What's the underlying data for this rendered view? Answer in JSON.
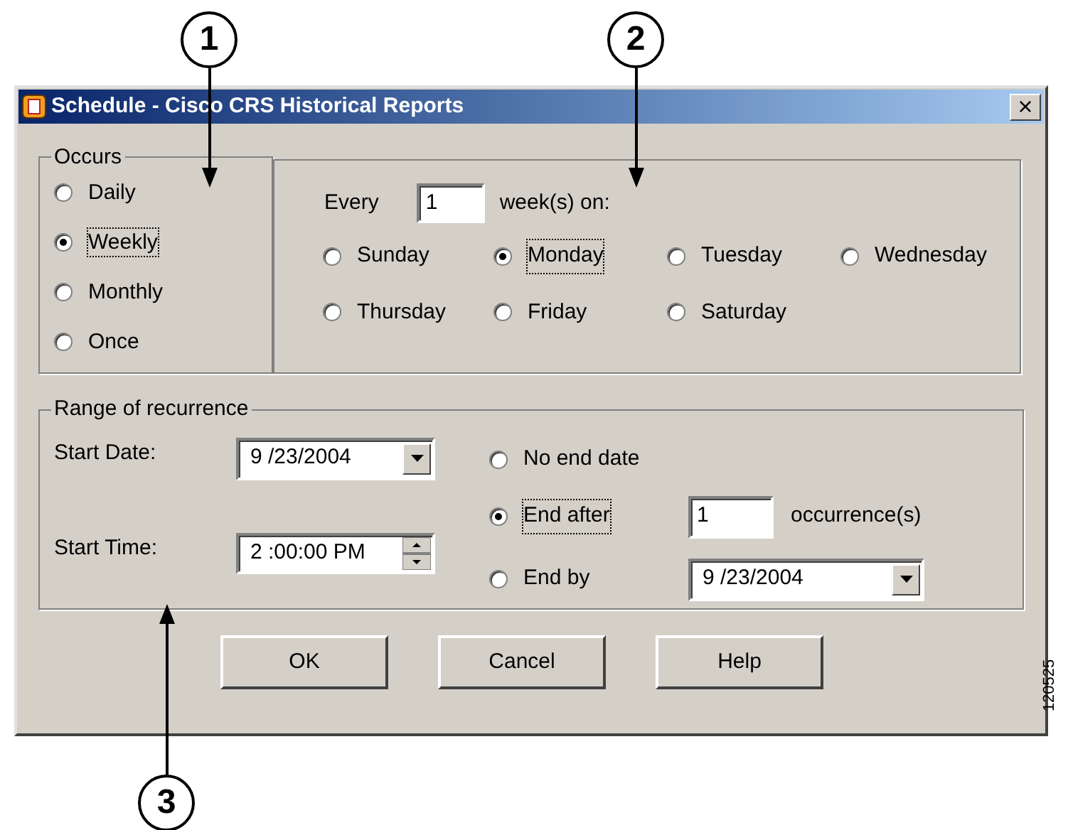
{
  "callouts": [
    "1",
    "2",
    "3"
  ],
  "window": {
    "title": "Schedule - Cisco CRS Historical Reports",
    "close": "×"
  },
  "occurs": {
    "legend": "Occurs",
    "options": [
      {
        "label": "Daily",
        "selected": false
      },
      {
        "label": "Weekly",
        "selected": true
      },
      {
        "label": "Monthly",
        "selected": false
      },
      {
        "label": "Once",
        "selected": false
      }
    ]
  },
  "weekly": {
    "every_label": "Every",
    "every_value": "1",
    "unit_label": "week(s) on:",
    "days": [
      {
        "label": "Sunday",
        "selected": false
      },
      {
        "label": "Monday",
        "selected": true
      },
      {
        "label": "Tuesday",
        "selected": false
      },
      {
        "label": "Wednesday",
        "selected": false
      },
      {
        "label": "Thursday",
        "selected": false
      },
      {
        "label": "Friday",
        "selected": false
      },
      {
        "label": "Saturday",
        "selected": false
      }
    ]
  },
  "range": {
    "legend": "Range of recurrence",
    "start_date_label": "Start Date:",
    "start_date": "9 /23/2004",
    "start_time_label": "Start Time:",
    "start_time": "2 :00:00 PM",
    "end_options": [
      {
        "kind": "none",
        "label": "No end date",
        "selected": false
      },
      {
        "kind": "count",
        "label": "End after",
        "selected": true,
        "value": "1",
        "suffix": "occurrence(s)"
      },
      {
        "kind": "date",
        "label": "End by",
        "selected": false,
        "value": "9 /23/2004"
      }
    ]
  },
  "buttons": [
    "OK",
    "Cancel",
    "Help"
  ],
  "figure_id": "120525"
}
